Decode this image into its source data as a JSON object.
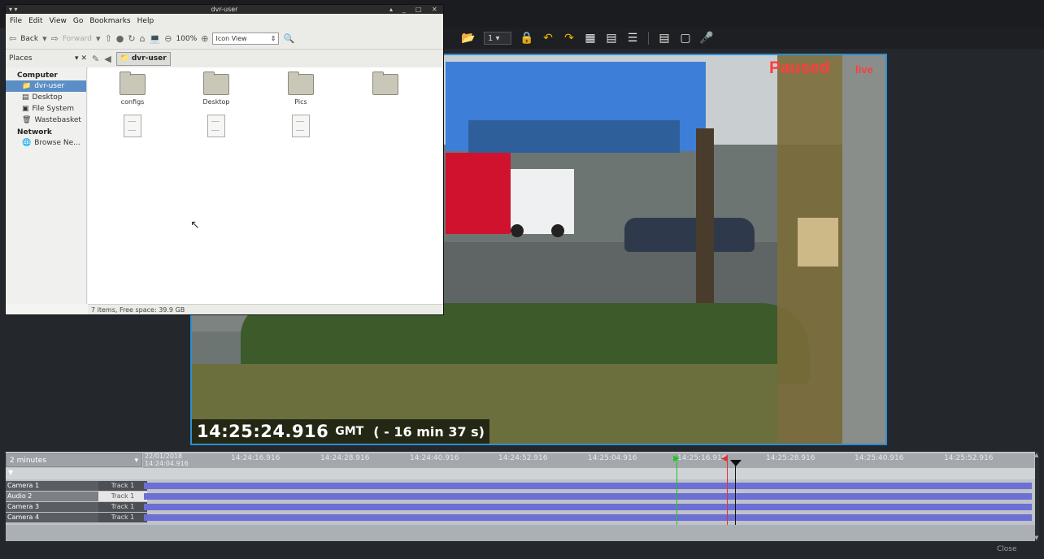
{
  "dvr": {
    "toolbar": {
      "channel_value": "1",
      "icons": [
        "folder-icon",
        "channel-select",
        "lock-icon",
        "undo-icon",
        "redo-icon",
        "export-icon",
        "caption-icon",
        "bars-icon",
        "list-icon",
        "screen-icon",
        "record-icon"
      ]
    },
    "video": {
      "status": "Paused",
      "status_flag": "live",
      "timestamp_time": "14:25:24.916",
      "timestamp_zone": "GMT",
      "timestamp_offset": "( - 16 min 37 s)"
    }
  },
  "file_manager": {
    "title": "dvr-user",
    "menu": [
      "File",
      "Edit",
      "View",
      "Go",
      "Bookmarks",
      "Help"
    ],
    "toolbar": {
      "back": "Back",
      "forward": "Forward",
      "zoom": "100%",
      "view_mode": "Icon View"
    },
    "places_label": "Places",
    "breadcrumb": "dvr-user",
    "sidebar": {
      "computer_heading": "Computer",
      "computer_items": [
        "dvr-user",
        "Desktop",
        "File System",
        "Wastebasket"
      ],
      "network_heading": "Network",
      "network_items": [
        "Browse Ne..."
      ]
    },
    "files": [
      {
        "name": "configs",
        "kind": "folder"
      },
      {
        "name": "Desktop",
        "kind": "folder"
      },
      {
        "name": "Pics",
        "kind": "folder"
      },
      {
        "name": "",
        "kind": "folder"
      },
      {
        "name": "",
        "kind": "doc"
      },
      {
        "name": "",
        "kind": "doc"
      },
      {
        "name": "",
        "kind": "doc"
      }
    ],
    "status": "7 items, Free space: 39.9 GB"
  },
  "timeline": {
    "zoom": "2 minutes",
    "date_line1": "22/01/2018",
    "date_line2": "14:24:04.916",
    "ticks": [
      "14:24:16.916",
      "14:24:28.916",
      "14:24:40.916",
      "14:24:52.916",
      "14:25:04.916",
      "14:25:16.916",
      "14:25:28.916",
      "14:25:40.916",
      "14:25:52.916"
    ],
    "rows": [
      {
        "name": "Camera 1",
        "track": "Track 1"
      },
      {
        "name": "Audio 2",
        "track": "Track 1"
      },
      {
        "name": "Camera 3",
        "track": "Track 1"
      },
      {
        "name": "Camera 4",
        "track": "Track 1"
      }
    ],
    "close_label": "Close"
  }
}
